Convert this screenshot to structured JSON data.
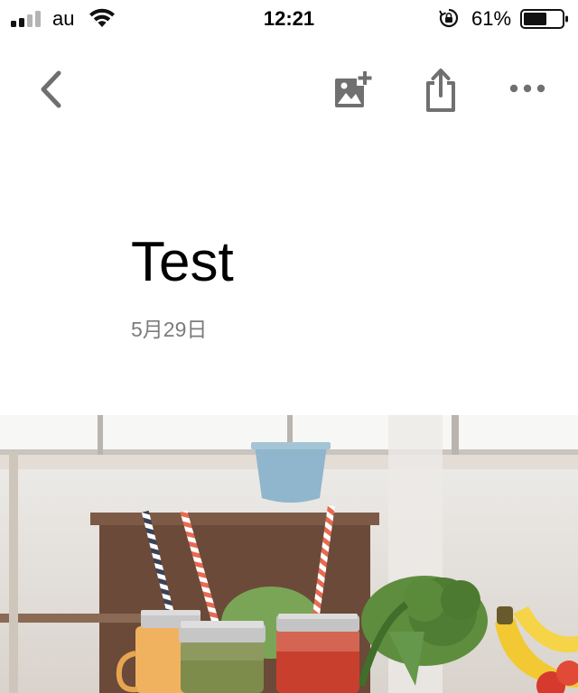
{
  "status_bar": {
    "carrier": "au",
    "time": "12:21",
    "battery_percent": "61%",
    "battery_level": 0.61,
    "signal_bars_active": 2,
    "signal_bars_total": 4
  },
  "toolbar": {
    "back_icon": "chevron-left-icon",
    "add_image_icon": "add-image-icon",
    "share_icon": "share-icon",
    "more_icon": "more-horizontal-icon"
  },
  "note": {
    "title": "Test",
    "date": "5月29日"
  },
  "colors": {
    "icon_gray": "#707070",
    "date_gray": "#7c7c7c",
    "text": "#000000",
    "background": "#ffffff"
  }
}
